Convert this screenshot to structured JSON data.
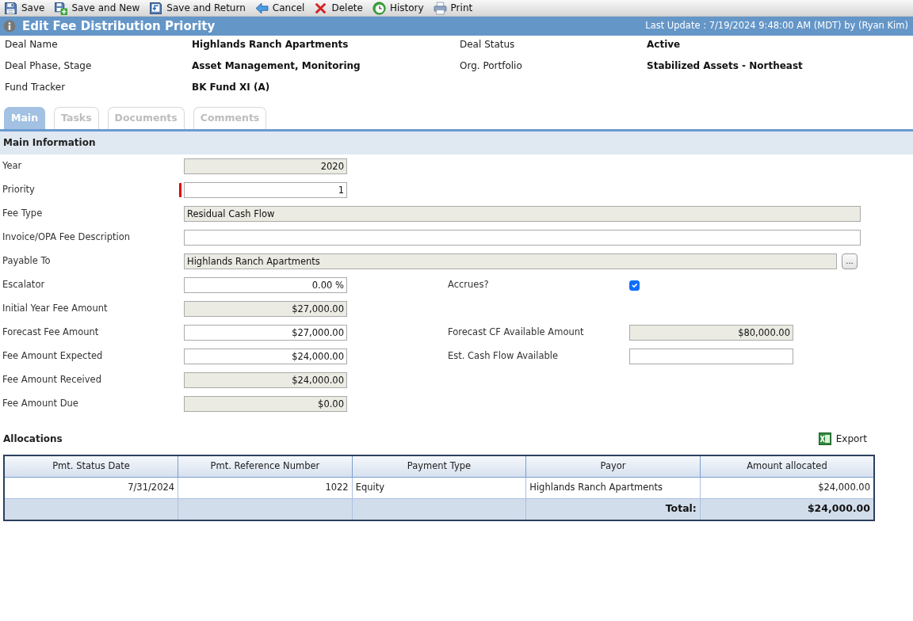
{
  "toolbar": [
    {
      "label": "Save"
    },
    {
      "label": "Save and New"
    },
    {
      "label": "Save and Return"
    },
    {
      "label": "Cancel"
    },
    {
      "label": "Delete"
    },
    {
      "label": "History"
    },
    {
      "label": "Print"
    }
  ],
  "title_bar": {
    "title": "Edit Fee Distribution Priority",
    "last_update": "Last Update : 7/19/2024 9:48:00 AM (MDT) by (Ryan Kim)"
  },
  "deal_info": [
    {
      "label": "Deal Name",
      "value": "Highlands Ranch Apartments"
    },
    {
      "label": "Deal Status",
      "value": "Active"
    },
    {
      "label": "Deal Phase, Stage",
      "value": "Asset Management, Monitoring"
    },
    {
      "label": "Org. Portfolio",
      "value": "Stabilized Assets - Northeast"
    },
    {
      "label": "Fund Tracker",
      "value": "BK Fund XI (A)"
    }
  ],
  "tabs": [
    {
      "label": "Main",
      "selected": true
    },
    {
      "label": "Tasks",
      "selected": false
    },
    {
      "label": "Documents",
      "selected": false
    },
    {
      "label": "Comments",
      "selected": false
    }
  ],
  "main_information": {
    "title": "Main Information",
    "rows": [
      {
        "fields": [
          {
            "kind": "number",
            "label": "Year",
            "value": "2020",
            "readonly": true,
            "required": false
          }
        ]
      },
      {
        "fields": [
          {
            "kind": "number",
            "label": "Priority",
            "value": "1",
            "readonly": false,
            "required": true
          }
        ]
      },
      {
        "fields": [
          {
            "kind": "text",
            "label": "Fee Type",
            "value": "Residual Cash Flow",
            "readonly": true,
            "required": false
          }
        ]
      },
      {
        "fields": [
          {
            "kind": "text",
            "label": "Invoice/OPA Fee Description",
            "readonly": false,
            "required": false
          }
        ]
      },
      {
        "fields": [
          {
            "kind": "lookup",
            "label": "Payable To",
            "value": "Highlands Ranch Apartments",
            "readonly": true,
            "required": false,
            "button_label": "..."
          }
        ]
      },
      {
        "fields": [
          {
            "kind": "number",
            "label": "Escalator",
            "value": "0.00 %",
            "readonly": false,
            "required": false
          },
          {
            "kind": "checkbox",
            "label": "Accrues?",
            "checked": true,
            "required": false
          }
        ]
      },
      {
        "fields": [
          {
            "kind": "number",
            "label": "Initial Year Fee Amount",
            "value": "$27,000.00",
            "readonly": true,
            "required": false
          }
        ]
      },
      {
        "fields": [
          {
            "kind": "number",
            "label": "Forecast Fee Amount",
            "value": "$27,000.00",
            "readonly": false,
            "required": false
          },
          {
            "kind": "number",
            "label": "Forecast CF Available Amount",
            "value": "$80,000.00",
            "readonly": true,
            "required": false
          }
        ]
      },
      {
        "fields": [
          {
            "kind": "number",
            "label": "Fee Amount Expected",
            "value": "$24,000.00",
            "readonly": false,
            "required": false
          },
          {
            "kind": "number",
            "label": "Est. Cash Flow Available",
            "readonly": false,
            "required": false
          }
        ]
      },
      {
        "fields": [
          {
            "kind": "number",
            "label": "Fee Amount Received",
            "value": "$24,000.00",
            "readonly": true,
            "required": false
          }
        ]
      },
      {
        "fields": [
          {
            "kind": "number",
            "label": "Fee Amount Due",
            "value": "$0.00",
            "readonly": true,
            "required": false
          }
        ]
      }
    ]
  },
  "allocations": {
    "title": "Allocations",
    "export": "Export",
    "table": {
      "columns": [
        {
          "label": "Pmt. Status Date",
          "kind": "number"
        },
        {
          "label": "Pmt. Reference Number",
          "kind": "number"
        },
        {
          "label": "Payment Type",
          "kind": "text"
        },
        {
          "label": "Payor",
          "kind": "text"
        },
        {
          "label": "Amount allocated",
          "kind": "number"
        }
      ],
      "rows": [
        [
          "7/31/2024",
          "1022",
          "Equity",
          "Highlands Ranch Apartments",
          "$24,000.00"
        ]
      ],
      "total": {
        "label": "Total:",
        "value": "$24,000.00"
      }
    }
  }
}
